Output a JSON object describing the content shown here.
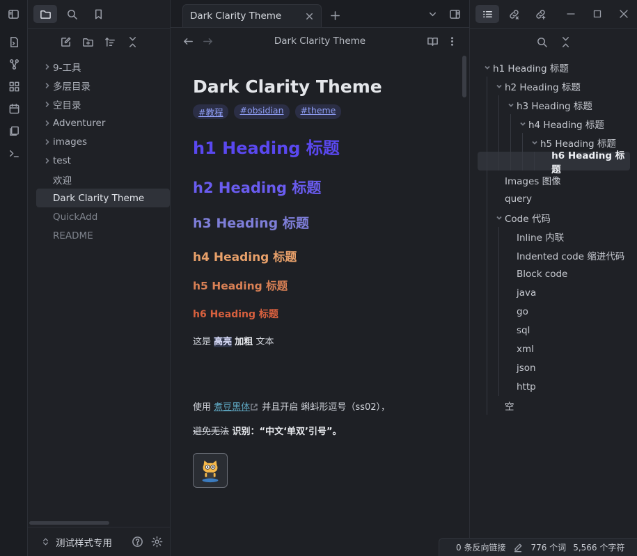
{
  "left_panel": {
    "tree": [
      {
        "label": "9-工具",
        "type": "folder"
      },
      {
        "label": "多层目录",
        "type": "folder"
      },
      {
        "label": "空目录",
        "type": "folder"
      },
      {
        "label": "Adventurer",
        "type": "folder"
      },
      {
        "label": "images",
        "type": "folder"
      },
      {
        "label": "test",
        "type": "folder"
      },
      {
        "label": "欢迎",
        "type": "file"
      },
      {
        "label": "Dark Clarity Theme",
        "type": "file",
        "active": true
      },
      {
        "label": "QuickAdd",
        "type": "file"
      },
      {
        "label": "README",
        "type": "file"
      }
    ],
    "vault_name": "测试样式专用"
  },
  "tab": {
    "title": "Dark Clarity Theme"
  },
  "view_header": {
    "title": "Dark Clarity Theme"
  },
  "document": {
    "title": "Dark Clarity Theme",
    "tags": [
      "#教程",
      "#obsidian",
      "#theme"
    ],
    "h1": "h1 Heading 标题",
    "h2": "h2 Heading 标题",
    "h3": "h3 Heading 标题",
    "h4": "h4 Heading 标题",
    "h5": "h5 Heading 标题",
    "h6": "h6 Heading 标题",
    "para1": {
      "pre": "这是 ",
      "highlight": "高亮",
      "bold": "加粗",
      "post": " 文本"
    },
    "para2": {
      "pre": "使用 ",
      "link": "煮豆黑体",
      "post": " 并且开启 蝌蚪形逗号（ss02），"
    },
    "para3": {
      "strike": "避免无法",
      "post": " 识别：“中文‘单双’引号”。"
    }
  },
  "outline": [
    {
      "label": "h1 Heading 标题",
      "depth": 0,
      "collapsible": true
    },
    {
      "label": "h2 Heading 标题",
      "depth": 1,
      "collapsible": true
    },
    {
      "label": "h3 Heading 标题",
      "depth": 2,
      "collapsible": true
    },
    {
      "label": "h4 Heading 标题",
      "depth": 3,
      "collapsible": true
    },
    {
      "label": "h5 Heading 标题",
      "depth": 4,
      "collapsible": true
    },
    {
      "label": "h6 Heading 标题",
      "depth": 5,
      "collapsible": false,
      "active": true
    },
    {
      "label": "Images 图像",
      "depth": 1,
      "collapsible": false
    },
    {
      "label": "query",
      "depth": 1,
      "collapsible": false
    },
    {
      "label": "Code 代码",
      "depth": 1,
      "collapsible": true
    },
    {
      "label": "Inline 内联",
      "depth": 2,
      "collapsible": false
    },
    {
      "label": "Indented code 缩进代码",
      "depth": 2,
      "collapsible": false
    },
    {
      "label": "Block code",
      "depth": 2,
      "collapsible": false
    },
    {
      "label": "java",
      "depth": 2,
      "collapsible": false
    },
    {
      "label": "go",
      "depth": 2,
      "collapsible": false
    },
    {
      "label": "sql",
      "depth": 2,
      "collapsible": false
    },
    {
      "label": "xml",
      "depth": 2,
      "collapsible": false
    },
    {
      "label": "json",
      "depth": 2,
      "collapsible": false
    },
    {
      "label": "http",
      "depth": 2,
      "collapsible": false
    },
    {
      "label": "空",
      "depth": 1,
      "collapsible": false
    }
  ],
  "status_bar": {
    "backlinks": "0 条反向链接",
    "words": "776 个词",
    "chars": "5,566 个字符"
  },
  "colors": {
    "accent": "#5a48f0",
    "background": "#1e2025",
    "h4": "#e8a06a",
    "h6": "#d8603e"
  }
}
